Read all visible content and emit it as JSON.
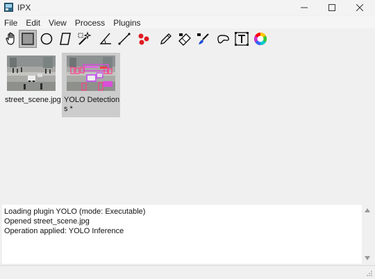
{
  "window": {
    "title": "IPX"
  },
  "menu": [
    "File",
    "Edit",
    "View",
    "Process",
    "Plugins"
  ],
  "toolbar": {
    "tools": [
      "hand-tool",
      "rectangle-select-tool",
      "ellipse-select-tool",
      "polygon-select-tool",
      "magic-wand-tool",
      "angle-tool",
      "line-tool",
      "points-tool",
      "pencil-tool",
      "eraser-tool",
      "brush-tool",
      "lasso-tool",
      "text-tool",
      "color-picker-tool"
    ],
    "active_tool": "rectangle-select-tool"
  },
  "gallery": {
    "items": [
      {
        "label": "street_scene.jpg",
        "selected": false
      },
      {
        "label": "YOLO Detections *",
        "selected": true
      }
    ]
  },
  "log": {
    "lines": [
      "Loading plugin YOLO (mode: Executable)",
      "Opened street_scene.jpg",
      "Operation applied: YOLO Inference"
    ]
  },
  "colors": {
    "selection": "#cccccc",
    "background": "#f0f0f0"
  }
}
